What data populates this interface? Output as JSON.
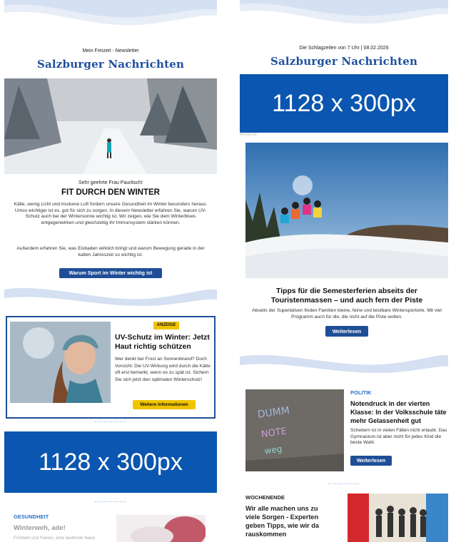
{
  "left": {
    "preheader": "Mein Freizeit - Newsletter",
    "logo": "Salzburger Nachrichten",
    "greeting": "Sehr geehrte Frau Pauritsch!",
    "headline": "FIT DURCH DEN WINTER",
    "intro1": "Kälte, wenig Licht und trockene Luft fordern unsere Gesundheit im Winter besonders heraus. Umso wichtiger ist es, gut für sich zu sorgen. In diesem Newsletter erfahren Sie, warum UV-Schutz auch bei der Wintersonne wichtig ist. Wir zeigen, wie Sie dem Winterblues entgegenwirken und gleichzeitig Ihr Immunsystem stärken können.",
    "intro2": "Außerdem erfahren Sie, was Eisbaden wirklich bringt und warum Bewegung gerade in der kalten Jahreszeit so wichtig ist.",
    "cta": "Warum Sport im Winter wichtig ist",
    "ad": {
      "badge": "ANZEIGE",
      "title": "UV-Schutz im Winter: Jetzt Haut richtig schützen",
      "text": "Wer denkt bei Frost an Sonnenbrand? Doch Vorsicht: Die UV-Wirkung wird durch die Kälte oft erst bemerkt, wenn es zu spät ist. Sichern Sie sich jetzt den optimalen Winterschutz!",
      "button": "Weitere Informationen"
    },
    "dots": "..............",
    "banner": "1128 x 300px",
    "dots2": "..............",
    "bottom": {
      "section": "GESUNDHEIT",
      "title": "Winterweh, ade!",
      "teaser": "Frösteln und frieren, eine laufende Nase"
    }
  },
  "right": {
    "preheader": "Die Schlagzeilen von 7 Uhr | 08.02.2026",
    "logo": "Salzburger Nachrichten",
    "banner": "1128 x 300px",
    "adlabel": "ANZEIGE",
    "feature": {
      "title": "Tipps für die Semesterferien abseits der Touristenmassen – und auch fern der Piste",
      "text": "Abseits der Superlativen finden Familien kleine, feine und leistbare Wintersportorte. Mit viel Programm auch für die, die nicht auf die Piste wollen.",
      "button": "Weiterlesen"
    },
    "politics": {
      "section": "POLITIK",
      "title": "Notendruck in der vierten Klasse: In der Volksschule täte mehr Gelassenheit gut",
      "text": "Scheitern ist in vielen Fällen nicht erlaubt. Das Gymnasium ist aber nicht für jedes Kind die beste Wahl.",
      "button": "Weiterlesen"
    },
    "dots": "..............",
    "weekend": {
      "section": "WOCHENENDE",
      "title": "Wir alle machen uns zu viele Sorgen - Experten geben Tipps, wie wir da rauskommen"
    }
  },
  "colors": {
    "brand": "#1e4f9c",
    "banner": "#0b56b0",
    "wave": "#d5e1f2",
    "badge": "#f1c400"
  }
}
